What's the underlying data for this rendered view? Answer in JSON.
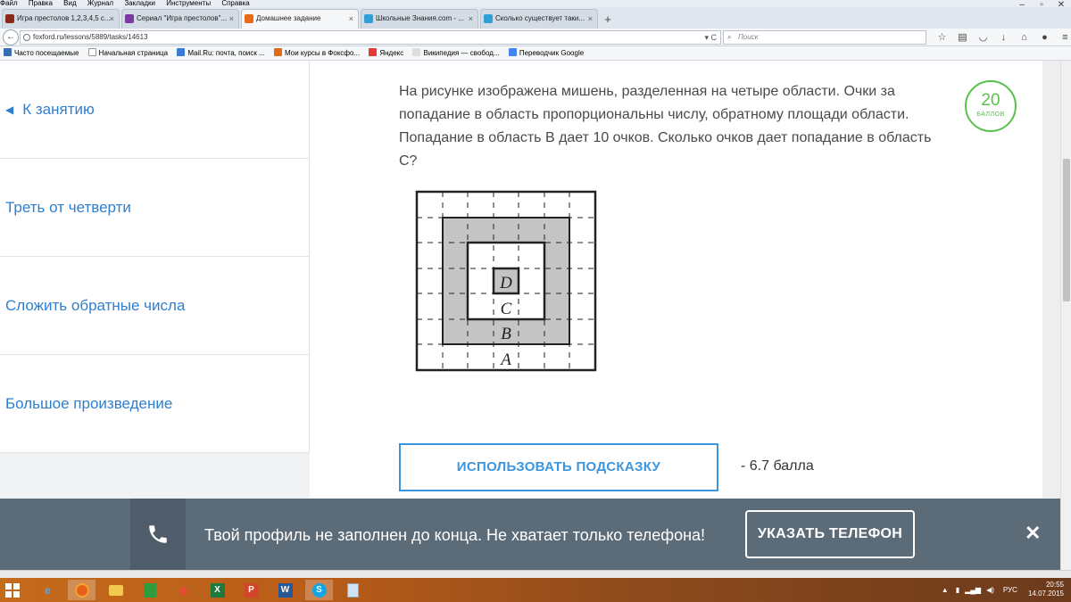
{
  "browser": {
    "menu": [
      "Файл",
      "Правка",
      "Вид",
      "Журнал",
      "Закладки",
      "Инструменты",
      "Справка"
    ],
    "tabs": [
      {
        "label": "Игра престолов 1,2,3,4,5 с...",
        "color": "#8a2a1a",
        "active": false
      },
      {
        "label": "Сериал \"Игра престолов\"...",
        "color": "#7a3aa0",
        "active": false
      },
      {
        "label": "Домашнее задание",
        "color": "#e86a1a",
        "active": true
      },
      {
        "label": "Школьные Знания.com - ...",
        "color": "#2fa0d8",
        "active": false
      },
      {
        "label": "Сколько существует таки...",
        "color": "#2fa0d8",
        "active": false
      }
    ],
    "url": "foxford.ru/lessons/5889/tasks/14613",
    "search_placeholder": "Поиск",
    "bookmarks": [
      {
        "label": "Часто посещаемые",
        "icon": "folder-icon"
      },
      {
        "label": "Начальная страница",
        "icon": "page-icon"
      },
      {
        "label": "Mail.Ru: почта, поиск ...",
        "icon": "mailru-icon"
      },
      {
        "label": "Мои курсы в Фоксфо...",
        "icon": "foxford-icon"
      },
      {
        "label": "Яндекс",
        "icon": "yandex-icon"
      },
      {
        "label": "Википедия — свобод...",
        "icon": "wikipedia-icon"
      },
      {
        "label": "Переводчик Google",
        "icon": "translate-icon"
      }
    ]
  },
  "sidebar": {
    "back_label": "К занятию",
    "items": [
      {
        "label": "Треть от четверти"
      },
      {
        "label": "Сложить обратные числа"
      },
      {
        "label": "Большое произведение"
      }
    ]
  },
  "task": {
    "text": "На рисунке изображена мишень, разделенная на четыре области. Очки за попадание в область пропорциональны числу, обратному площади области. Попадание в область B дает 10 очков. Сколько очков дает попадание в область C?",
    "points": "20",
    "points_label": "БАЛЛОВ",
    "figure_labels": [
      "D",
      "C",
      "B",
      "A"
    ],
    "hint_button": "ИСПОЛЬЗОВАТЬ ПОДСКАЗКУ",
    "hint_cost": "- 6.7 балла"
  },
  "notification": {
    "message": "Твой профиль не заполнен до конца. Не хватает только телефона!",
    "button": "УКАЗАТЬ ТЕЛЕФОН"
  },
  "taskbar": {
    "apps": [
      "ie-icon",
      "firefox-icon",
      "explorer-icon",
      "calc-icon",
      "viewer-icon",
      "excel-icon",
      "powerpoint-icon",
      "word-icon",
      "skype-icon",
      "notes-icon"
    ],
    "language": "РУС",
    "time": "20:55",
    "date": "14.07.2015"
  },
  "colors": {
    "accent_blue": "#3d95dc",
    "badge_green": "#57c14a",
    "notif_bg": "#5b6b78"
  }
}
